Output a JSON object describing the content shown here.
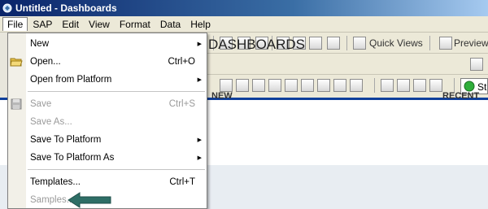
{
  "window": {
    "title": "Untitled - Dashboards"
  },
  "menubar": {
    "items": [
      "File",
      "SAP",
      "Edit",
      "View",
      "Format",
      "Data",
      "Help"
    ]
  },
  "toolbar": {
    "quick_views_label": "Quick Views",
    "preview_label": "Preview",
    "partial_label": "St"
  },
  "file_menu": {
    "items": [
      {
        "label": "New",
        "shortcut": "",
        "submenu": true,
        "enabled": true
      },
      {
        "label": "Open...",
        "shortcut": "Ctrl+O",
        "submenu": false,
        "enabled": true
      },
      {
        "label": "Open from Platform",
        "shortcut": "",
        "submenu": true,
        "enabled": true
      },
      {
        "label": "Save",
        "shortcut": "Ctrl+S",
        "submenu": false,
        "enabled": false
      },
      {
        "label": "Save As...",
        "shortcut": "",
        "submenu": false,
        "enabled": false
      },
      {
        "label": "Save To Platform",
        "shortcut": "",
        "submenu": true,
        "enabled": true
      },
      {
        "label": "Save To Platform As",
        "shortcut": "",
        "submenu": true,
        "enabled": true
      },
      {
        "label": "Templates...",
        "shortcut": "Ctrl+T",
        "submenu": false,
        "enabled": true
      },
      {
        "label": "Samples...",
        "shortcut": "",
        "submenu": false,
        "enabled": false
      }
    ]
  },
  "content": {
    "title": "DASHBOARDS",
    "col_new": "NEW",
    "col_recent": "RECENT"
  },
  "colors": {
    "title_bar": "#0a246a",
    "accent_line": "#0f3f9b",
    "pointer_arrow": "#2e6e66"
  }
}
